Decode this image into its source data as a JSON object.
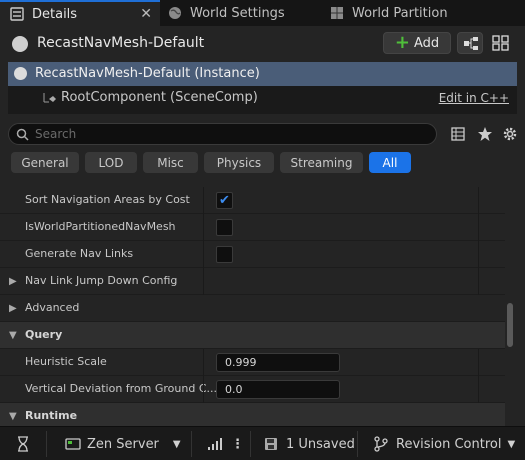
{
  "tabs": [
    {
      "label": "Details",
      "active": true
    },
    {
      "label": "World Settings",
      "active": false
    },
    {
      "label": "World Partition",
      "active": false
    }
  ],
  "header": {
    "title": "RecastNavMesh-Default",
    "add_label": "Add"
  },
  "tree": {
    "root": "RecastNavMesh-Default (Instance)",
    "child": "RootComponent (SceneComp)",
    "edit_link": "Edit in C++"
  },
  "search": {
    "placeholder": "Search",
    "value": ""
  },
  "filters": [
    "General",
    "LOD",
    "Misc",
    "Physics",
    "Streaming",
    "All"
  ],
  "active_filter": "All",
  "properties": [
    {
      "name": "Sort Navigation Areas by Cost",
      "type": "checkbox",
      "checked": true
    },
    {
      "name": "IsWorldPartitionedNavMesh",
      "type": "checkbox",
      "checked": false
    },
    {
      "name": "Generate Nav Links",
      "type": "checkbox",
      "checked": false
    },
    {
      "name": "Nav Link Jump Down Config",
      "type": "struct"
    },
    {
      "name": "Advanced",
      "type": "group"
    },
    {
      "name": "Query",
      "type": "category"
    },
    {
      "name": "Heuristic Scale",
      "type": "number",
      "value": "0.999"
    },
    {
      "name": "Vertical Deviation from Ground C...",
      "type": "number",
      "value": "0.0"
    },
    {
      "name": "Runtime",
      "type": "category"
    }
  ],
  "statusbar": {
    "server": "Zen Server",
    "unsaved": "1 Unsaved",
    "revision": "Revision Control"
  },
  "colors": {
    "accent": "#1b73e8",
    "selection": "#4a5d78",
    "add_plus": "#4fbf3a",
    "check": "#3d8df0"
  }
}
